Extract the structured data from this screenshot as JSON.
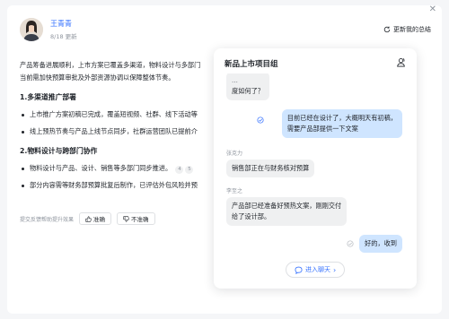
{
  "header": {
    "author": "王青青",
    "date": "8/18 更新",
    "update_link": "更新我的总结"
  },
  "summary": {
    "intro": [
      "产品筹备进展顺利，上市方案已覆盖多渠道，物料设计与多部门",
      "当前需加快预算审批及外部资源协调以保障整体节奏。"
    ],
    "sections": [
      {
        "title": "1.多渠道推广部署",
        "bullets": [
          "上市推广方案初稿已完成，覆盖短视频、社群、线下活动等",
          "线上预热节奏与产品上线节点同步，社群运营团队已提前介"
        ]
      },
      {
        "title": "2.物料设计与跨部门协作",
        "bullets": [
          "物料设计与产品、设计、销售等多部门同步推进。",
          "部分内容需等财务部预算批复后制作，已评估外包风险并预"
        ]
      }
    ],
    "refs": [
      "4",
      "5"
    ]
  },
  "feedback": {
    "prompt": "提交反馈帮助提升效果",
    "accurate": "准确",
    "inaccurate": "不准确"
  },
  "chat": {
    "title": "新品上市项目组",
    "messages": [
      {
        "side": "left",
        "text_line1": "...",
        "text_line2": "度如何了？"
      },
      {
        "side": "right",
        "text_line1": "目前已经在设计了，大概明天有初稿，",
        "text_line2": "需要产品部提供一下文案"
      },
      {
        "side": "left",
        "sender": "张克力",
        "text": "销售部正在与财务核对预算"
      },
      {
        "side": "left",
        "sender": "李至之",
        "text_line1": "产品部已经准备好预热文案，刚刚交付",
        "text_line2": "给了设计部。"
      },
      {
        "side": "right",
        "text": "好的，收到"
      }
    ],
    "enter_button": "进入聊天"
  },
  "colors": {
    "accent": "#3370ff",
    "bubble_self": "#cfe5ff",
    "bubble_other": "#eff0f1"
  }
}
